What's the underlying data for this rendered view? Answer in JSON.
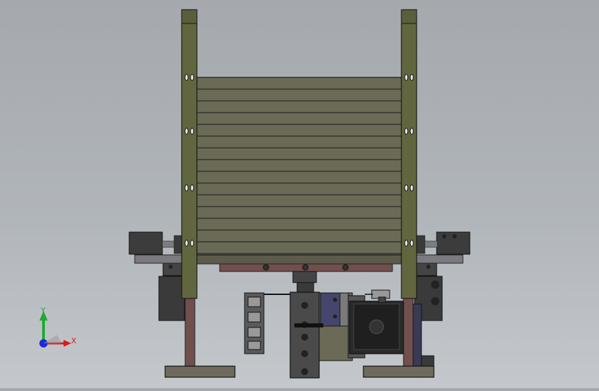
{
  "viewport": {
    "view": "front",
    "colors": {
      "background_top": "#a5a9ad",
      "background_bottom": "#c4c8cc",
      "frame_olive": "#61663f",
      "slats": "#6a6a56",
      "base_plates": "#6e6b5e",
      "dark_parts": "#3a3a3a",
      "rails": "#704f4d",
      "motor": "#2a2a2a",
      "bracket": "#4a4a4a"
    }
  },
  "triad": {
    "x_label": "X",
    "y_label": "Y",
    "x_color": "#d21e1e",
    "y_color": "#1eaa32",
    "z_color": "#1e2adc"
  }
}
